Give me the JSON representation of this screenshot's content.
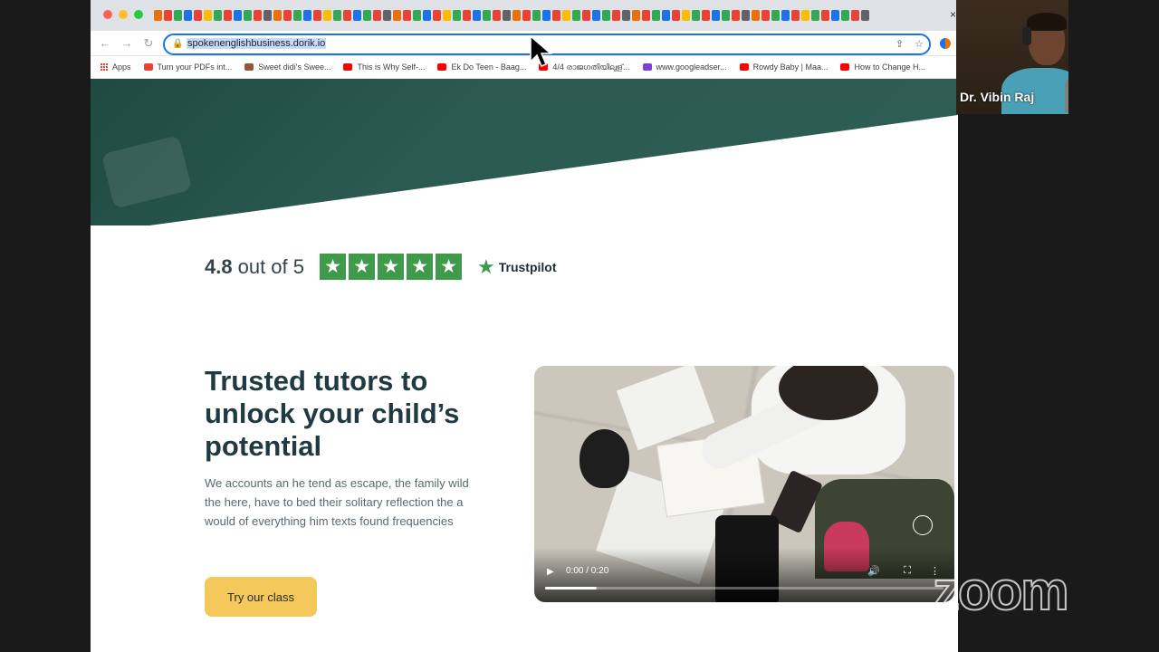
{
  "browser": {
    "url": "spokenenglishbusiness.dorik.io",
    "bookmarks": [
      {
        "label": "Apps",
        "color": "#ea4335"
      },
      {
        "label": "Turn your PDFs int...",
        "color": "#e94235"
      },
      {
        "label": "Sweet didi's Swee...",
        "color": "#8d5b3c"
      },
      {
        "label": "This is Why Self-...",
        "color": "#ff0000"
      },
      {
        "label": "Ek Do Teen - Baag...",
        "color": "#ff0000"
      },
      {
        "label": "4/4 രാജഗതിയിലുള്...",
        "color": "#ff0000"
      },
      {
        "label": "www.googleadser...",
        "color": "#7e3fd4"
      },
      {
        "label": "Rowdy Baby | Maa...",
        "color": "#ff0000"
      },
      {
        "label": "How to Change H...",
        "color": "#ff0000"
      }
    ],
    "tab_close": "×"
  },
  "hero": {
    "rating_score": "4.8",
    "rating_text": "out of 5",
    "stars": [
      "★",
      "★",
      "★",
      "★",
      "★"
    ],
    "trustpilot_label": "Trustpilot",
    "headline": "Trusted tutors to unlock your child’s potential",
    "body": "We accounts an he tend as escape, the family wild the here, have to bed their solitary reflection the a would of everything him texts found frequencies",
    "cta_label": "Try our class",
    "accent_color": "#f5c85b",
    "band_color": "#2b5a50",
    "star_color": "#3f9a4c"
  },
  "video": {
    "time": "0:00 / 0:20",
    "progress_fraction": 0.13,
    "icons": [
      "play-icon",
      "volume-icon",
      "fullscreen-icon",
      "more-icon"
    ]
  },
  "webcam": {
    "name": "Dr. Vibin Raj"
  },
  "overlay": {
    "brand": "zoom"
  }
}
